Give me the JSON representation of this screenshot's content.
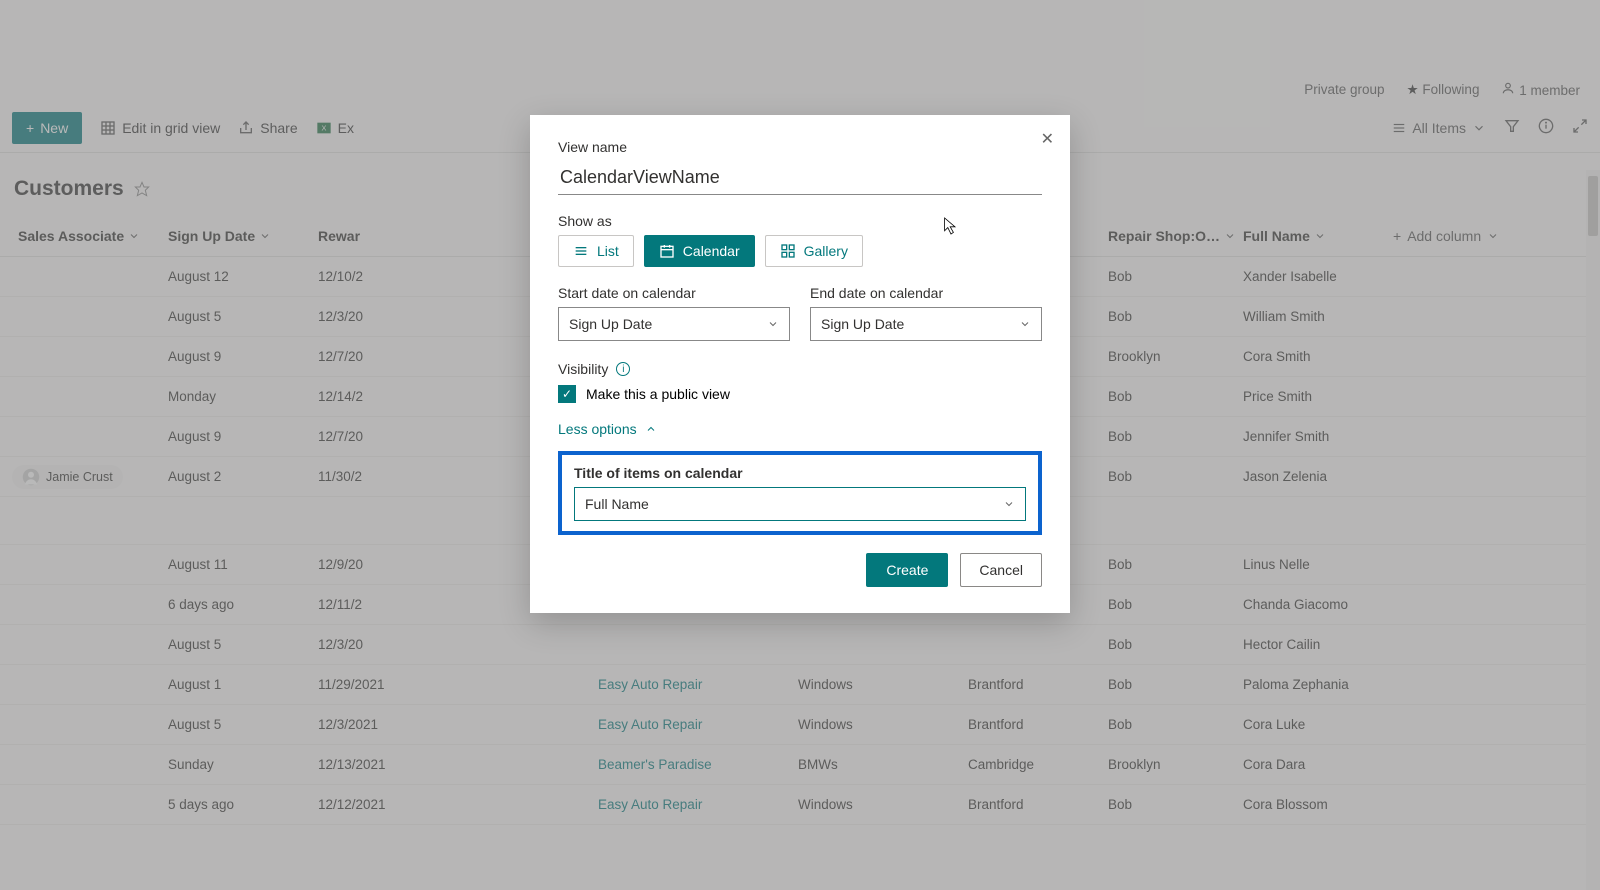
{
  "infoBar": {
    "privacy": "Private group",
    "following": "Following",
    "members": "1 member"
  },
  "toolbar": {
    "newLabel": "New",
    "editGrid": "Edit in grid view",
    "share": "Share",
    "exportPartial": "Ex",
    "viewSelector": "All Items"
  },
  "list": {
    "title": "Customers",
    "columns": {
      "salesAssociate": "Sales Associate",
      "signUpDate": "Sign Up Date",
      "rewar": "Rewar",
      "repairShop": "Repair Shop:O…",
      "fullName": "Full Name",
      "addColumn": "Add column"
    },
    "rows": [
      {
        "assoc": "",
        "signUp": "August 12",
        "date": "12/10/2",
        "shop": "",
        "sys": "",
        "city": "",
        "repair": "Bob",
        "full": "Xander Isabelle"
      },
      {
        "assoc": "",
        "signUp": "August 5",
        "date": "12/3/20",
        "shop": "",
        "sys": "",
        "city": "",
        "repair": "Bob",
        "full": "William Smith"
      },
      {
        "assoc": "",
        "signUp": "August 9",
        "date": "12/7/20",
        "shop": "",
        "sys": "",
        "city": "",
        "repair": "Brooklyn",
        "full": "Cora Smith"
      },
      {
        "assoc": "",
        "signUp": "Monday",
        "date": "12/14/2",
        "shop": "",
        "sys": "",
        "city": "",
        "repair": "Bob",
        "full": "Price Smith"
      },
      {
        "assoc": "",
        "signUp": "August 9",
        "date": "12/7/20",
        "shop": "",
        "sys": "",
        "city": "",
        "repair": "Bob",
        "full": "Jennifer Smith"
      },
      {
        "assoc": "Jamie Crust",
        "signUp": "August 2",
        "date": "11/30/2",
        "shop": "",
        "sys": "",
        "city": "",
        "repair": "Bob",
        "full": "Jason Zelenia"
      },
      {
        "gap": true
      },
      {
        "assoc": "",
        "signUp": "August 11",
        "date": "12/9/20",
        "shop": "",
        "sys": "",
        "city": "",
        "repair": "Bob",
        "full": "Linus Nelle"
      },
      {
        "assoc": "",
        "signUp": "6 days ago",
        "date": "12/11/2",
        "shop": "",
        "sys": "",
        "city": "",
        "repair": "Bob",
        "full": "Chanda Giacomo"
      },
      {
        "assoc": "",
        "signUp": "August 5",
        "date": "12/3/20",
        "shop": "",
        "sys": "",
        "city": "",
        "repair": "Bob",
        "full": "Hector Cailin"
      },
      {
        "assoc": "",
        "signUp": "August 1",
        "date": "11/29/2021",
        "shop": "Easy Auto Repair",
        "sys": "Windows",
        "city": "Brantford",
        "repair": "Bob",
        "full": "Paloma Zephania"
      },
      {
        "assoc": "",
        "signUp": "August 5",
        "date": "12/3/2021",
        "shop": "Easy Auto Repair",
        "sys": "Windows",
        "city": "Brantford",
        "repair": "Bob",
        "full": "Cora Luke"
      },
      {
        "assoc": "",
        "signUp": "Sunday",
        "date": "12/13/2021",
        "shop": "Beamer's Paradise",
        "sys": "BMWs",
        "city": "Cambridge",
        "repair": "Brooklyn",
        "full": "Cora Dara"
      },
      {
        "assoc": "",
        "signUp": "5 days ago",
        "date": "12/12/2021",
        "shop": "Easy Auto Repair",
        "sys": "Windows",
        "city": "Brantford",
        "repair": "Bob",
        "full": "Cora Blossom"
      }
    ]
  },
  "dialog": {
    "viewNameLabel": "View name",
    "viewNameValue": "CalendarViewName",
    "showAsLabel": "Show as",
    "showAs": {
      "list": "List",
      "calendar": "Calendar",
      "gallery": "Gallery"
    },
    "startDateLabel": "Start date on calendar",
    "startDateValue": "Sign Up Date",
    "endDateLabel": "End date on calendar",
    "endDateValue": "Sign Up Date",
    "visibilityLabel": "Visibility",
    "publicCheckbox": "Make this a public view",
    "lessOptions": "Less options",
    "titleItemsLabel": "Title of items on calendar",
    "titleItemsValue": "Full Name",
    "create": "Create",
    "cancel": "Cancel"
  }
}
